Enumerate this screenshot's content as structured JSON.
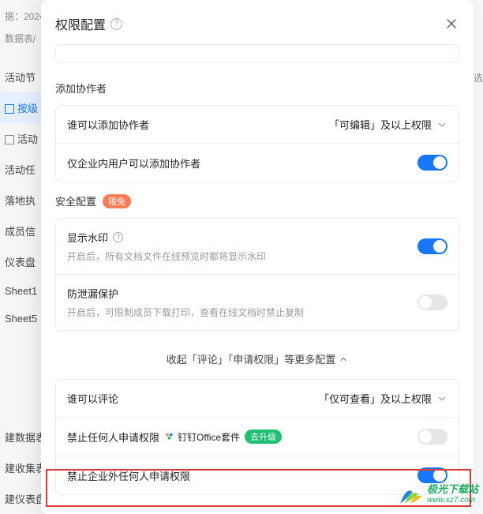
{
  "bg": {
    "topInfo": "据：2024",
    "crumb": "数据表/",
    "edge": "选",
    "items": [
      "活动节",
      "按级",
      "活动",
      "活动任",
      "落地执",
      "成员信",
      "仪表盘",
      "Sheet1",
      "Sheet5"
    ],
    "selectedIndex": 1,
    "bottom": [
      "建数据表",
      "建收集表",
      "建仪表盘"
    ]
  },
  "panel": {
    "title": "权限配置",
    "sections": {
      "collab": {
        "title": "添加协作者",
        "whoCanAdd": {
          "label": "谁可以添加协作者",
          "value": "「可编辑」及以上权限"
        },
        "internalOnly": {
          "label": "仅企业内用户可以添加协作者",
          "on": true
        }
      },
      "security": {
        "title": "安全配置",
        "badge": "限免",
        "watermark": {
          "label": "显示水印",
          "desc": "开启后，所有文档文件在线预览时都将显示水印",
          "on": true
        },
        "leak": {
          "label": "防泄漏保护",
          "desc": "开启后，可限制成员下载打印，查看在线文档时禁止复制",
          "on": false
        }
      },
      "collapse": "收起「评论」「申请权限」等更多配置",
      "more": {
        "whoCanComment": {
          "label": "谁可以评论",
          "value": "「仅可查看」及以上权限"
        },
        "forbidAnyRequest": {
          "label": "禁止任何人申请权限",
          "suite": "钉钉Office套件",
          "upgrade": "去升级",
          "on": false
        },
        "forbidExternalRequest": {
          "label": "禁止企业外任何人申请权限",
          "on": true
        }
      }
    }
  },
  "watermark": {
    "a": "极光下载站",
    "b": "www.xz7.com"
  }
}
